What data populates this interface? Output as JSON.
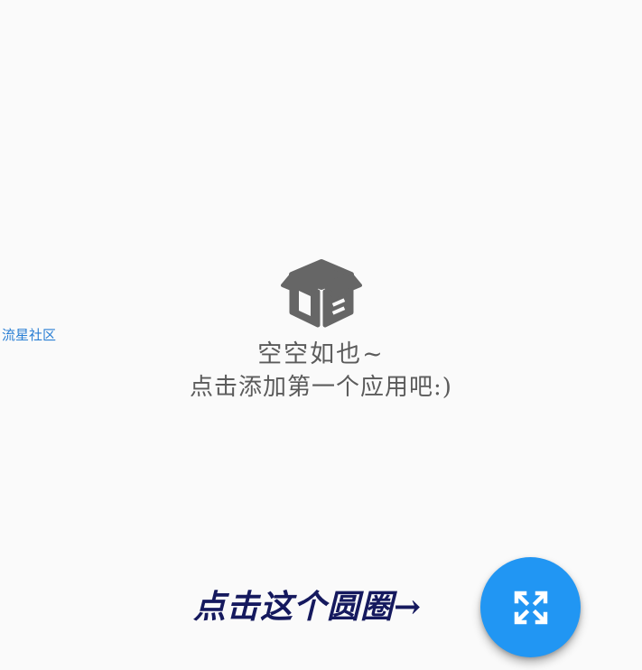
{
  "side_link": {
    "label": "流星社区"
  },
  "empty_state": {
    "icon": "empty-box-icon",
    "title": "空空如也~",
    "subtitle": "点击添加第一个应用吧:)"
  },
  "hint": {
    "text": "点击这个圆圈→"
  },
  "fab": {
    "icon": "expand-arrows-icon"
  },
  "colors": {
    "background": "#fafafa",
    "accent": "#2196f3",
    "link": "#2a7fd4",
    "empty_text": "#5b5b5b",
    "hint_text": "#15195e"
  }
}
